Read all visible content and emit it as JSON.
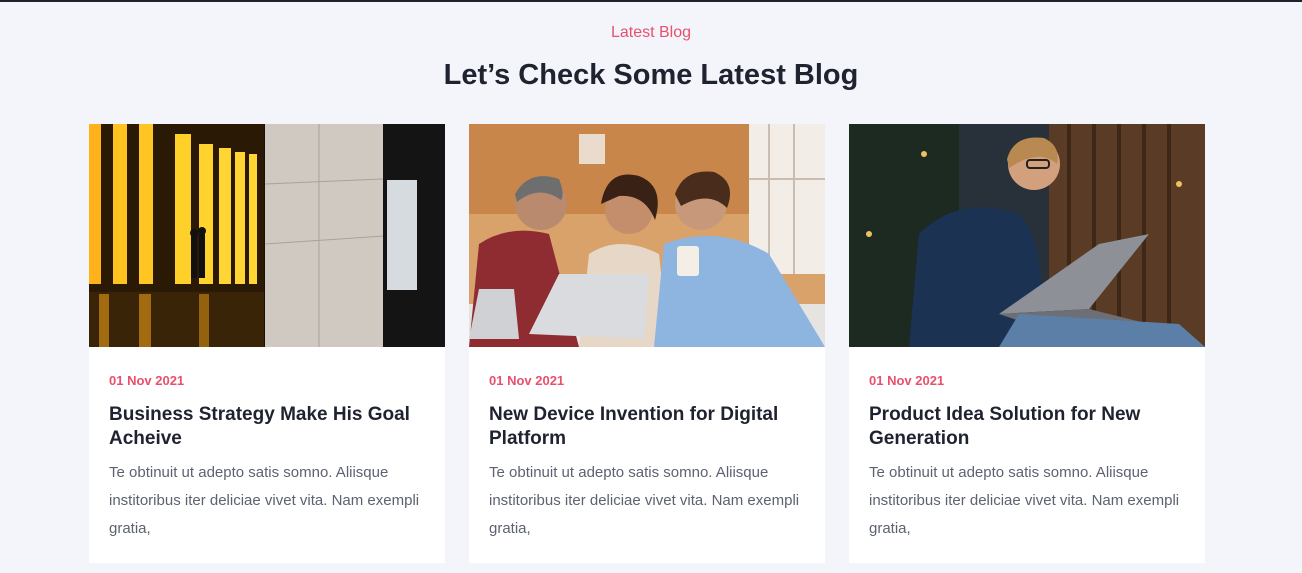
{
  "section": {
    "eyebrow": "Latest Blog",
    "heading": "Let’s Check Some Latest Blog"
  },
  "posts": [
    {
      "date": "01 Nov 2021",
      "title": "Business Strategy Make His Goal Acheive",
      "excerpt": "Te obtinuit ut adepto satis somno. Aliisque institoribus iter deliciae vivet vita. Nam exempli gratia,"
    },
    {
      "date": "01 Nov 2021",
      "title": "New Device Invention for Digital Platform",
      "excerpt": "Te obtinuit ut adepto satis somno. Aliisque institoribus iter deliciae vivet vita. Nam exempli gratia,"
    },
    {
      "date": "01 Nov 2021",
      "title": "Product Idea Solution for New Generation",
      "excerpt": "Te obtinuit ut adepto satis somno. Aliisque institoribus iter deliciae vivet vita. Nam exempli gratia,"
    }
  ],
  "colors": {
    "accent": "#e8506e",
    "heading": "#1f2330",
    "body_text": "#5c6270",
    "background": "#f3f5fb"
  }
}
